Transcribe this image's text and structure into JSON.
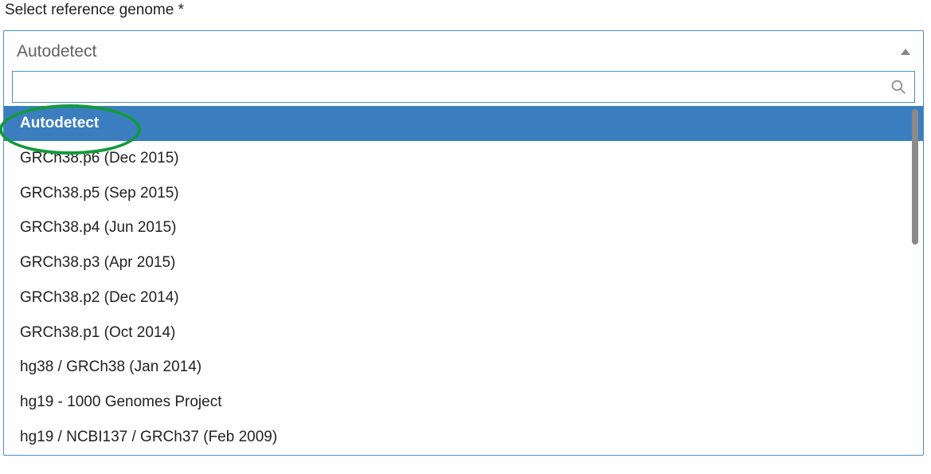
{
  "field": {
    "label": "Select reference genome *"
  },
  "select": {
    "selected_value": "Autodetect",
    "search_value": "",
    "options": [
      "Autodetect",
      "GRCh38.p6 (Dec 2015)",
      "GRCh38.p5 (Sep 2015)",
      "GRCh38.p4 (Jun 2015)",
      "GRCh38.p3 (Apr 2015)",
      "GRCh38.p2 (Dec 2014)",
      "GRCh38.p1 (Oct 2014)",
      "hg38 / GRCh38 (Jan 2014)",
      "hg19 - 1000 Genomes Project",
      "hg19 / NCBI137 / GRCh37 (Feb 2009)"
    ],
    "selected_index": 0
  }
}
